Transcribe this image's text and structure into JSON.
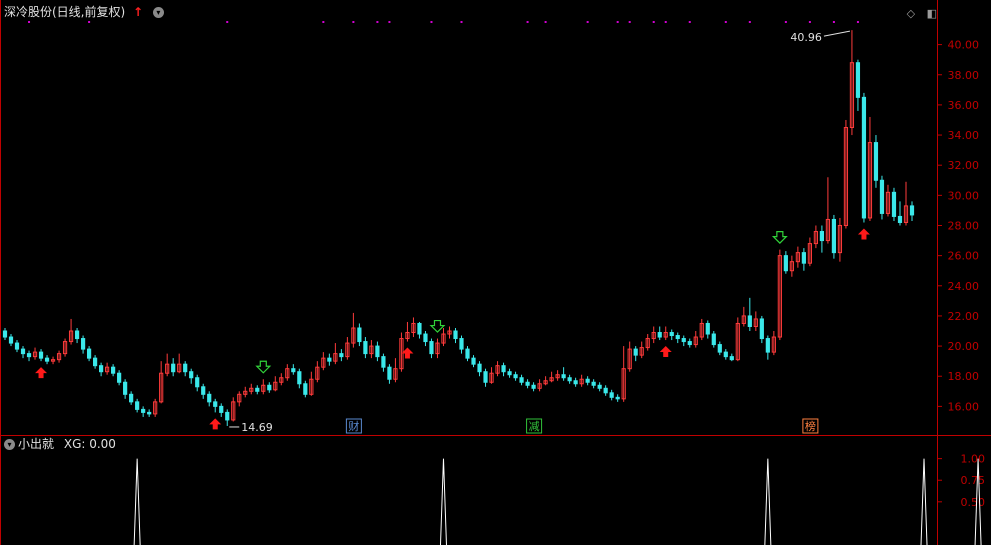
{
  "header": {
    "title": "深冷股份(日线,前复权)",
    "up_indicator": "↑"
  },
  "subpanel": {
    "name": "小出就",
    "xg_label": "XG: 0.00"
  },
  "icons": [
    "up-arrow-icon",
    "settings-circle-icon",
    "diamond-icon",
    "panel-toggle-icon",
    "collapse-circle-icon"
  ],
  "colors": {
    "up": "#ff3b3b",
    "down": "#3be8ea",
    "axis": "#c00000",
    "buy": "#ff1a1a",
    "sell": "#31d23a",
    "marker": "#d000d0"
  },
  "chart_data": {
    "type": "candlestick",
    "price_axis": {
      "ticks": [
        16,
        18,
        20,
        22,
        24,
        26,
        28,
        30,
        32,
        34,
        36,
        38,
        40
      ],
      "range": [
        14.3,
        41.5
      ]
    },
    "high_label": "40.96",
    "low_label": "14.69",
    "candles": [
      [
        21.0,
        20.6,
        21.2,
        20.4
      ],
      [
        20.6,
        20.2,
        20.8,
        20.0
      ],
      [
        20.2,
        19.8,
        20.4,
        19.6
      ],
      [
        19.8,
        19.5,
        20.0,
        19.2
      ],
      [
        19.5,
        19.3,
        19.7,
        19.0
      ],
      [
        19.3,
        19.6,
        19.9,
        19.1
      ],
      [
        19.6,
        19.2,
        19.8,
        19.0
      ],
      [
        19.2,
        19.0,
        19.4,
        18.8
      ],
      [
        19.0,
        19.1,
        19.3,
        18.8
      ],
      [
        19.1,
        19.5,
        19.7,
        18.9
      ],
      [
        19.5,
        20.3,
        20.5,
        19.3
      ],
      [
        20.3,
        21.0,
        21.8,
        20.1
      ],
      [
        21.0,
        20.5,
        21.2,
        20.2
      ],
      [
        20.5,
        19.8,
        20.7,
        19.5
      ],
      [
        19.8,
        19.2,
        20.0,
        19.0
      ],
      [
        19.2,
        18.7,
        19.4,
        18.5
      ],
      [
        18.7,
        18.3,
        18.9,
        18.0
      ],
      [
        18.3,
        18.6,
        18.9,
        18.1
      ],
      [
        18.6,
        18.2,
        18.8,
        18.0
      ],
      [
        18.2,
        17.6,
        18.4,
        17.4
      ],
      [
        17.6,
        16.8,
        17.8,
        16.5
      ],
      [
        16.8,
        16.3,
        17.0,
        16.1
      ],
      [
        16.3,
        15.8,
        16.5,
        15.6
      ],
      [
        15.8,
        15.6,
        16.0,
        15.3
      ],
      [
        15.6,
        15.5,
        15.8,
        15.3
      ],
      [
        15.5,
        16.3,
        16.5,
        15.3
      ],
      [
        16.3,
        18.2,
        19.0,
        16.2
      ],
      [
        18.2,
        18.8,
        19.5,
        18.0
      ],
      [
        18.8,
        18.3,
        19.2,
        18.0
      ],
      [
        18.3,
        18.8,
        19.5,
        18.2
      ],
      [
        18.8,
        18.3,
        19.0,
        18.0
      ],
      [
        18.3,
        17.9,
        18.5,
        17.5
      ],
      [
        17.9,
        17.3,
        18.1,
        17.0
      ],
      [
        17.3,
        16.8,
        17.5,
        16.5
      ],
      [
        16.8,
        16.3,
        17.0,
        16.0
      ],
      [
        16.3,
        16.0,
        16.5,
        15.6
      ],
      [
        16.0,
        15.6,
        16.2,
        15.3
      ],
      [
        15.6,
        15.1,
        15.8,
        14.7
      ],
      [
        15.1,
        16.3,
        16.6,
        15.0
      ],
      [
        16.3,
        16.8,
        17.0,
        16.0
      ],
      [
        16.8,
        17.0,
        17.3,
        16.6
      ],
      [
        17.0,
        17.2,
        17.5,
        16.8
      ],
      [
        17.2,
        17.0,
        17.4,
        16.8
      ],
      [
        17.0,
        17.4,
        17.8,
        16.8
      ],
      [
        17.4,
        17.1,
        17.6,
        16.9
      ],
      [
        17.1,
        17.6,
        18.0,
        17.0
      ],
      [
        17.6,
        17.9,
        18.2,
        17.4
      ],
      [
        17.9,
        18.5,
        18.8,
        17.7
      ],
      [
        18.5,
        18.3,
        18.8,
        18.1
      ],
      [
        18.3,
        17.5,
        18.5,
        17.2
      ],
      [
        17.5,
        16.8,
        17.7,
        16.6
      ],
      [
        16.8,
        17.8,
        18.3,
        16.7
      ],
      [
        17.8,
        18.6,
        19.0,
        17.6
      ],
      [
        18.6,
        19.2,
        19.6,
        18.4
      ],
      [
        19.2,
        19.0,
        19.5,
        18.7
      ],
      [
        19.0,
        19.5,
        20.2,
        18.8
      ],
      [
        19.5,
        19.3,
        19.8,
        19.0
      ],
      [
        19.3,
        20.2,
        20.6,
        19.1
      ],
      [
        20.2,
        21.2,
        22.2,
        19.9
      ],
      [
        21.2,
        20.3,
        21.5,
        20.0
      ],
      [
        20.3,
        19.5,
        20.6,
        19.2
      ],
      [
        19.5,
        20.0,
        20.4,
        19.2
      ],
      [
        20.0,
        19.3,
        20.3,
        19.0
      ],
      [
        19.3,
        18.6,
        19.5,
        18.3
      ],
      [
        18.6,
        17.8,
        18.8,
        17.5
      ],
      [
        17.8,
        18.5,
        19.2,
        17.6
      ],
      [
        18.5,
        20.5,
        20.9,
        18.3
      ],
      [
        20.5,
        20.9,
        21.6,
        20.3
      ],
      [
        20.9,
        21.5,
        21.9,
        20.6
      ],
      [
        21.5,
        20.8,
        21.6,
        20.5
      ],
      [
        20.8,
        20.3,
        21.0,
        20.0
      ],
      [
        20.3,
        19.5,
        20.5,
        19.2
      ],
      [
        19.5,
        20.2,
        20.5,
        19.2
      ],
      [
        20.2,
        20.8,
        21.2,
        20.0
      ],
      [
        20.8,
        21.0,
        21.3,
        20.5
      ],
      [
        21.0,
        20.5,
        21.2,
        20.2
      ],
      [
        20.5,
        19.8,
        20.7,
        19.5
      ],
      [
        19.8,
        19.2,
        20.0,
        19.0
      ],
      [
        19.2,
        18.8,
        19.4,
        18.6
      ],
      [
        18.8,
        18.3,
        19.0,
        18.0
      ],
      [
        18.3,
        17.6,
        18.5,
        17.3
      ],
      [
        17.6,
        18.2,
        18.6,
        17.5
      ],
      [
        18.2,
        18.7,
        19.0,
        18.0
      ],
      [
        18.7,
        18.3,
        18.9,
        18.0
      ],
      [
        18.3,
        18.1,
        18.5,
        17.9
      ],
      [
        18.1,
        17.9,
        18.3,
        17.7
      ],
      [
        17.9,
        17.6,
        18.1,
        17.4
      ],
      [
        17.6,
        17.4,
        17.8,
        17.2
      ],
      [
        17.4,
        17.2,
        17.6,
        17.0
      ],
      [
        17.2,
        17.5,
        17.8,
        17.0
      ],
      [
        17.5,
        17.7,
        18.0,
        17.4
      ],
      [
        17.7,
        17.9,
        18.3,
        17.6
      ],
      [
        17.9,
        18.1,
        18.4,
        17.7
      ],
      [
        18.1,
        17.9,
        18.6,
        17.7
      ],
      [
        17.9,
        17.7,
        18.1,
        17.5
      ],
      [
        17.7,
        17.5,
        17.9,
        17.3
      ],
      [
        17.5,
        17.8,
        18.1,
        17.3
      ],
      [
        17.8,
        17.6,
        18.0,
        17.4
      ],
      [
        17.6,
        17.4,
        17.8,
        17.2
      ],
      [
        17.4,
        17.2,
        17.6,
        17.0
      ],
      [
        17.2,
        16.9,
        17.4,
        16.7
      ],
      [
        16.9,
        16.6,
        17.1,
        16.4
      ],
      [
        16.6,
        16.5,
        16.8,
        16.3
      ],
      [
        16.5,
        18.5,
        20.0,
        16.3
      ],
      [
        18.5,
        19.8,
        20.3,
        18.3
      ],
      [
        19.8,
        19.4,
        20.0,
        19.0
      ],
      [
        19.4,
        19.9,
        20.3,
        19.2
      ],
      [
        19.9,
        20.5,
        20.8,
        19.7
      ],
      [
        20.5,
        20.9,
        21.3,
        20.2
      ],
      [
        20.9,
        20.6,
        21.3,
        20.4
      ],
      [
        20.6,
        20.9,
        21.3,
        20.4
      ],
      [
        20.9,
        20.7,
        21.1,
        20.4
      ],
      [
        20.7,
        20.5,
        20.9,
        20.2
      ],
      [
        20.5,
        20.3,
        20.7,
        20.0
      ],
      [
        20.3,
        20.1,
        20.5,
        19.9
      ],
      [
        20.1,
        20.6,
        21.0,
        19.9
      ],
      [
        20.6,
        21.5,
        21.8,
        20.4
      ],
      [
        21.5,
        20.8,
        21.7,
        20.5
      ],
      [
        20.8,
        20.1,
        21.0,
        19.9
      ],
      [
        20.1,
        19.6,
        20.3,
        19.4
      ],
      [
        19.6,
        19.3,
        19.8,
        19.1
      ],
      [
        19.3,
        19.1,
        19.5,
        19.0
      ],
      [
        19.1,
        21.5,
        21.9,
        19.0
      ],
      [
        21.5,
        22.0,
        22.6,
        21.3
      ],
      [
        22.0,
        21.3,
        23.2,
        21.0
      ],
      [
        21.3,
        21.8,
        22.3,
        21.0
      ],
      [
        21.8,
        20.5,
        22.0,
        20.2
      ],
      [
        20.5,
        19.6,
        20.7,
        19.1
      ],
      [
        19.6,
        20.6,
        21.0,
        19.4
      ],
      [
        20.6,
        26.0,
        26.4,
        20.4
      ],
      [
        26.0,
        25.0,
        26.3,
        24.8
      ],
      [
        25.0,
        25.6,
        26.0,
        24.6
      ],
      [
        25.6,
        26.2,
        26.6,
        25.2
      ],
      [
        26.2,
        25.5,
        26.5,
        25.0
      ],
      [
        25.5,
        26.8,
        27.2,
        25.3
      ],
      [
        26.8,
        27.6,
        28.0,
        26.5
      ],
      [
        27.6,
        27.0,
        28.0,
        26.2
      ],
      [
        27.0,
        28.4,
        31.2,
        26.8
      ],
      [
        28.4,
        26.2,
        28.7,
        25.8
      ],
      [
        26.2,
        28.0,
        28.5,
        25.6
      ],
      [
        28.0,
        34.5,
        35.0,
        27.8
      ],
      [
        34.5,
        38.8,
        40.96,
        34.0
      ],
      [
        38.8,
        36.5,
        39.0,
        35.6
      ],
      [
        36.5,
        28.5,
        36.8,
        28.2
      ],
      [
        28.5,
        33.5,
        35.2,
        28.3
      ],
      [
        33.5,
        31.0,
        34.0,
        30.5
      ],
      [
        31.0,
        28.8,
        31.3,
        28.4
      ],
      [
        28.8,
        30.2,
        30.7,
        28.6
      ],
      [
        30.2,
        28.6,
        30.5,
        28.3
      ],
      [
        28.6,
        28.2,
        29.6,
        28.0
      ],
      [
        28.2,
        29.3,
        30.9,
        28.0
      ],
      [
        29.3,
        28.7,
        29.6,
        28.3
      ]
    ],
    "buy_signal_indices": [
      6,
      35,
      67,
      110,
      143
    ],
    "sell_signal_indices": [
      43,
      72,
      129
    ],
    "event_labels": [
      {
        "index": 58,
        "text": "财"
      },
      {
        "index": 88,
        "text": "减"
      },
      {
        "index": 134,
        "text": "榜"
      }
    ],
    "magenta_marker_indices": [
      4,
      14,
      37,
      53,
      58,
      62,
      64,
      71,
      76,
      87,
      90,
      97,
      102,
      104,
      108,
      110,
      114,
      120,
      124,
      130,
      134,
      138,
      142
    ],
    "xg_axis": {
      "ticks": [
        0.5,
        0.75,
        1.0
      ],
      "range": [
        0,
        1.1
      ]
    },
    "xg_spike_indices": [
      22,
      73,
      127,
      153,
      162
    ]
  }
}
